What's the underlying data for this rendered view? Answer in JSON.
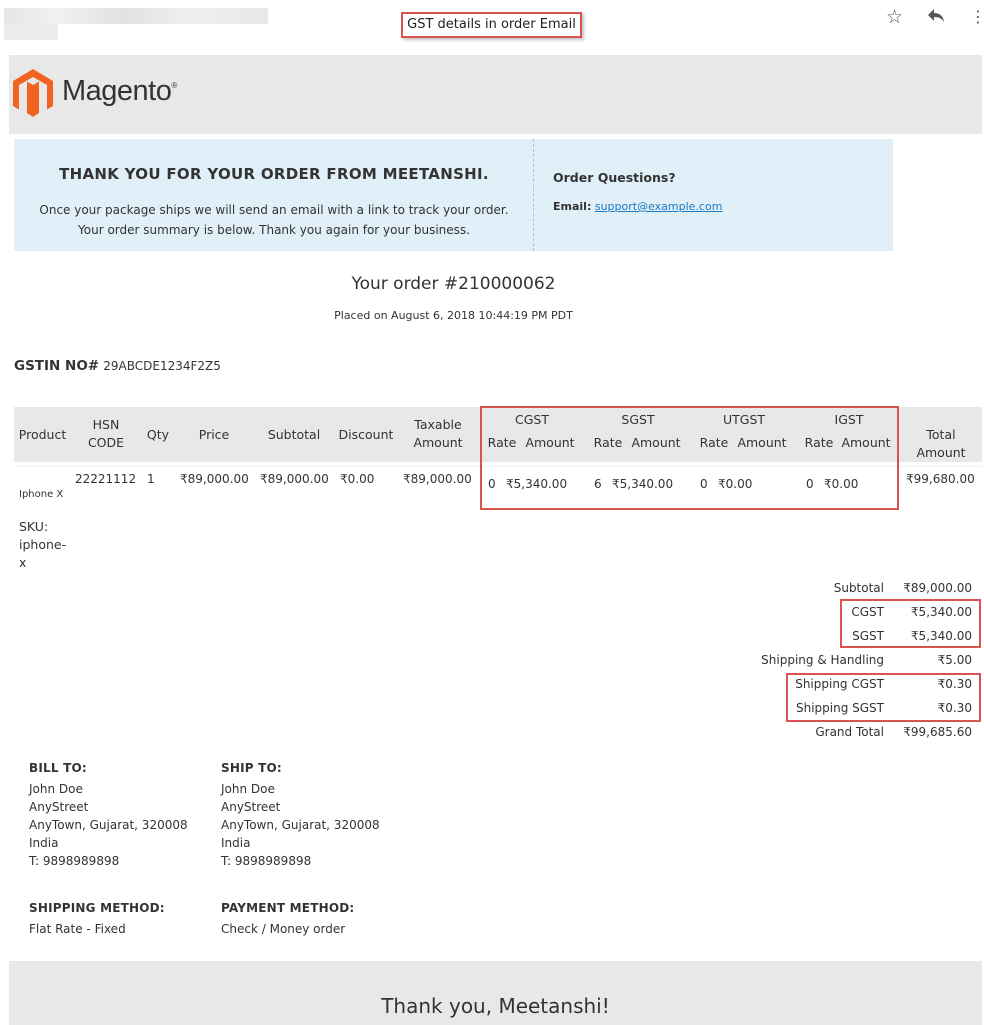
{
  "annotations": {
    "title_label": "GST details in order Email"
  },
  "brand": {
    "name": "Magento",
    "reg_mark": "®",
    "orange": "#f26322"
  },
  "thanks": {
    "title": "THANK YOU FOR YOUR ORDER FROM MEETANSHI.",
    "line1": "Once your package ships we will send an email with a link to track your order.",
    "line2": "Your order summary is below. Thank you again for your business.",
    "questions_title": "Order Questions?",
    "email_label": "Email:",
    "email": "support@example.com"
  },
  "order": {
    "title": "Your order #210000062",
    "placed": "Placed on August 6, 2018 10:44:19 PM PDT",
    "gstin_label": "GSTIN NO#",
    "gstin_value": "29ABCDE1234F2Z5"
  },
  "table": {
    "headers": {
      "product": "Product",
      "hsn1": "HSN",
      "hsn2": "CODE",
      "qty": "Qty",
      "price": "Price",
      "subtotal": "Subtotal",
      "discount": "Discount",
      "taxable1": "Taxable",
      "taxable2": "Amount",
      "cgst": "CGST",
      "sgst": "SGST",
      "utgst": "UTGST",
      "igst": "IGST",
      "rate": "Rate",
      "amount": "Amount",
      "total_amount": "Total Amount"
    },
    "row": {
      "product": "Iphone X",
      "sku_label": "SKU:",
      "sku_line1": "iphone-",
      "sku_line2": "x",
      "hsn": "22221112",
      "qty": "1",
      "price": "₹89,000.00",
      "subtotal": "₹89,000.00",
      "discount": "₹0.00",
      "taxable": "₹89,000.00",
      "cgst_rate": "0",
      "cgst_amount": "₹5,340.00",
      "sgst_rate": "6",
      "sgst_amount": "₹5,340.00",
      "utgst_rate": "0",
      "utgst_amount": "₹0.00",
      "igst_rate": "0",
      "igst_amount": "₹0.00",
      "total": "₹99,680.00"
    }
  },
  "totals": {
    "subtotal_label": "Subtotal",
    "subtotal": "₹89,000.00",
    "cgst_label": "CGST",
    "cgst": "₹5,340.00",
    "sgst_label": "SGST",
    "sgst": "₹5,340.00",
    "shipping_label": "Shipping & Handling",
    "shipping": "₹5.00",
    "ship_cgst_label": "Shipping CGST",
    "ship_cgst": "₹0.30",
    "ship_sgst_label": "Shipping SGST",
    "ship_sgst": "₹0.30",
    "grand_label": "Grand Total",
    "grand": "₹99,685.60"
  },
  "bill_to": {
    "heading": "BILL TO:",
    "name": "John Doe",
    "street": "AnyStreet",
    "city": "AnyTown, Gujarat, 320008",
    "country": "India",
    "phone": "T: 9898989898"
  },
  "ship_to": {
    "heading": "SHIP TO:",
    "name": "John Doe",
    "street": "AnyStreet",
    "city": "AnyTown, Gujarat, 320008",
    "country": "India",
    "phone": "T: 9898989898"
  },
  "shipping_method": {
    "heading": "SHIPPING METHOD:",
    "value": "Flat Rate - Fixed"
  },
  "payment_method": {
    "heading": "PAYMENT METHOD:",
    "value": "Check / Money order"
  },
  "footer": {
    "text": "Thank you, Meetanshi!"
  },
  "colors": {
    "annotation_red": "#d9534f",
    "link_blue": "#1979c3",
    "info_blue": "#e1eff8"
  }
}
